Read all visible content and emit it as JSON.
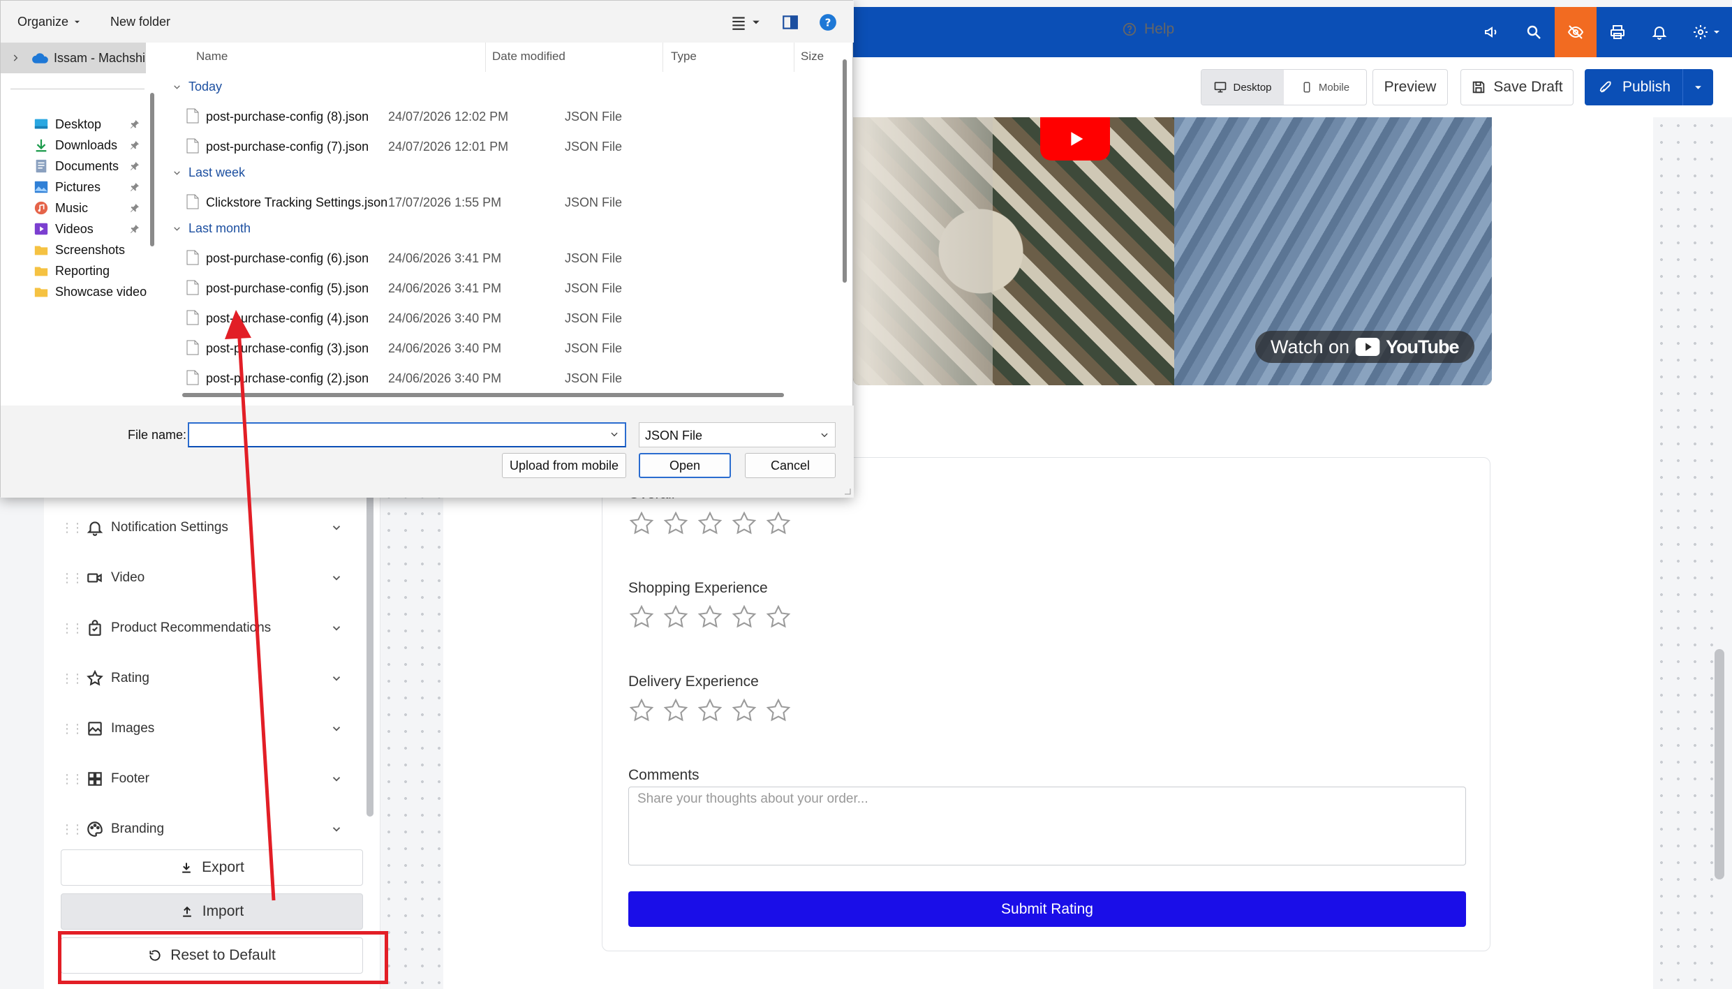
{
  "toolbar": {
    "help": "Help",
    "desktop": "Desktop",
    "mobile": "Mobile",
    "preview": "Preview",
    "save_draft": "Save Draft",
    "publish": "Publish"
  },
  "video": {
    "watch_on": "Watch on",
    "youtube": "YouTube"
  },
  "rating_form": {
    "overall_label": "Overall",
    "shopping_label": "Shopping Experience",
    "delivery_label": "Delivery Experience",
    "comments_label": "Comments",
    "comments_placeholder": "Share your thoughts about your order...",
    "submit": "Submit Rating",
    "star_count": 5
  },
  "sidebar": {
    "items": [
      {
        "label": "Notification Settings",
        "icon": "bell-icon"
      },
      {
        "label": "Video",
        "icon": "video-icon"
      },
      {
        "label": "Product Recommendations",
        "icon": "bag-icon"
      },
      {
        "label": "Rating",
        "icon": "star-icon"
      },
      {
        "label": "Images",
        "icon": "image-icon"
      },
      {
        "label": "Footer",
        "icon": "grid-icon"
      },
      {
        "label": "Branding",
        "icon": "palette-icon"
      }
    ],
    "export": "Export",
    "import": "Import",
    "reset": "Reset to Default"
  },
  "dialog": {
    "organize": "Organize",
    "new_folder": "New folder",
    "nav_root": "Issam - Machshi",
    "nav_items": [
      {
        "label": "Desktop",
        "pinned": true
      },
      {
        "label": "Downloads",
        "pinned": true
      },
      {
        "label": "Documents",
        "pinned": true
      },
      {
        "label": "Pictures",
        "pinned": true
      },
      {
        "label": "Music",
        "pinned": true
      },
      {
        "label": "Videos",
        "pinned": true
      },
      {
        "label": "Screenshots",
        "pinned": false
      },
      {
        "label": "Reporting",
        "pinned": false
      },
      {
        "label": "Showcase video",
        "pinned": false
      }
    ],
    "columns": [
      "Name",
      "Date modified",
      "Type",
      "Size"
    ],
    "groups": [
      {
        "label": "Today",
        "files": [
          {
            "name": "post-purchase-config (8).json",
            "date": "24/07/2026 12:02 PM",
            "type": "JSON File"
          },
          {
            "name": "post-purchase-config (7).json",
            "date": "24/07/2026 12:01 PM",
            "type": "JSON File"
          }
        ]
      },
      {
        "label": "Last week",
        "files": [
          {
            "name": "Clickstore Tracking Settings.json",
            "date": "17/07/2026 1:55 PM",
            "type": "JSON File"
          }
        ]
      },
      {
        "label": "Last month",
        "files": [
          {
            "name": "post-purchase-config (6).json",
            "date": "24/06/2026 3:41 PM",
            "type": "JSON File"
          },
          {
            "name": "post-purchase-config (5).json",
            "date": "24/06/2026 3:41 PM",
            "type": "JSON File"
          },
          {
            "name": "post-purchase-config (4).json",
            "date": "24/06/2026 3:40 PM",
            "type": "JSON File"
          },
          {
            "name": "post-purchase-config (3).json",
            "date": "24/06/2026 3:40 PM",
            "type": "JSON File"
          },
          {
            "name": "post-purchase-config (2).json",
            "date": "24/06/2026 3:40 PM",
            "type": "JSON File"
          }
        ]
      }
    ],
    "file_name_label": "File name:",
    "file_name_value": "",
    "file_type": "JSON File",
    "upload_mobile": "Upload from mobile",
    "open": "Open",
    "cancel": "Cancel"
  },
  "colors": {
    "brand_blue": "#0b4fb6",
    "accent_orange": "#f26b21",
    "submit_blue": "#1a0ee8",
    "annotation_red": "#e21e26"
  }
}
